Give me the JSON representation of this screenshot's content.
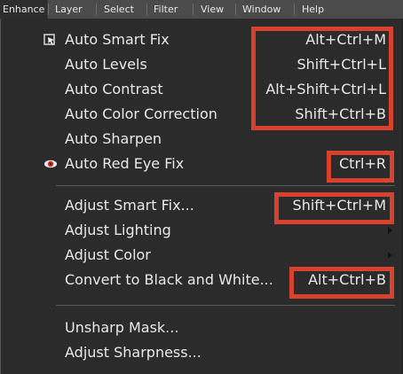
{
  "menubar": {
    "items": [
      "Enhance",
      "Layer",
      "Select",
      "Filter",
      "View",
      "Window",
      "Help"
    ]
  },
  "menu": {
    "items": [
      {
        "label": "Auto Smart Fix",
        "shortcut": "Alt+Ctrl+M",
        "icon": "smart-fix-icon"
      },
      {
        "label": "Auto Levels",
        "shortcut": "Shift+Ctrl+L"
      },
      {
        "label": "Auto Contrast",
        "shortcut": "Alt+Shift+Ctrl+L"
      },
      {
        "label": "Auto Color Correction",
        "shortcut": "Shift+Ctrl+B"
      },
      {
        "label": "Auto Sharpen",
        "shortcut": ""
      },
      {
        "label": "Auto Red Eye Fix",
        "shortcut": "Ctrl+R",
        "icon": "red-eye-icon"
      },
      {
        "label": "Adjust Smart Fix...",
        "shortcut": "Shift+Ctrl+M"
      },
      {
        "label": "Adjust Lighting",
        "shortcut": "",
        "submenu": true
      },
      {
        "label": "Adjust Color",
        "shortcut": "",
        "submenu": true
      },
      {
        "label": "Convert to Black and White...",
        "shortcut": "Alt+Ctrl+B"
      },
      {
        "label": "Unsharp Mask...",
        "shortcut": ""
      },
      {
        "label": "Adjust Sharpness...",
        "shortcut": ""
      }
    ]
  },
  "colors": {
    "highlight": "#d9412f",
    "menu_bg": "#2b2b2b",
    "text": "#e9e9e9"
  }
}
